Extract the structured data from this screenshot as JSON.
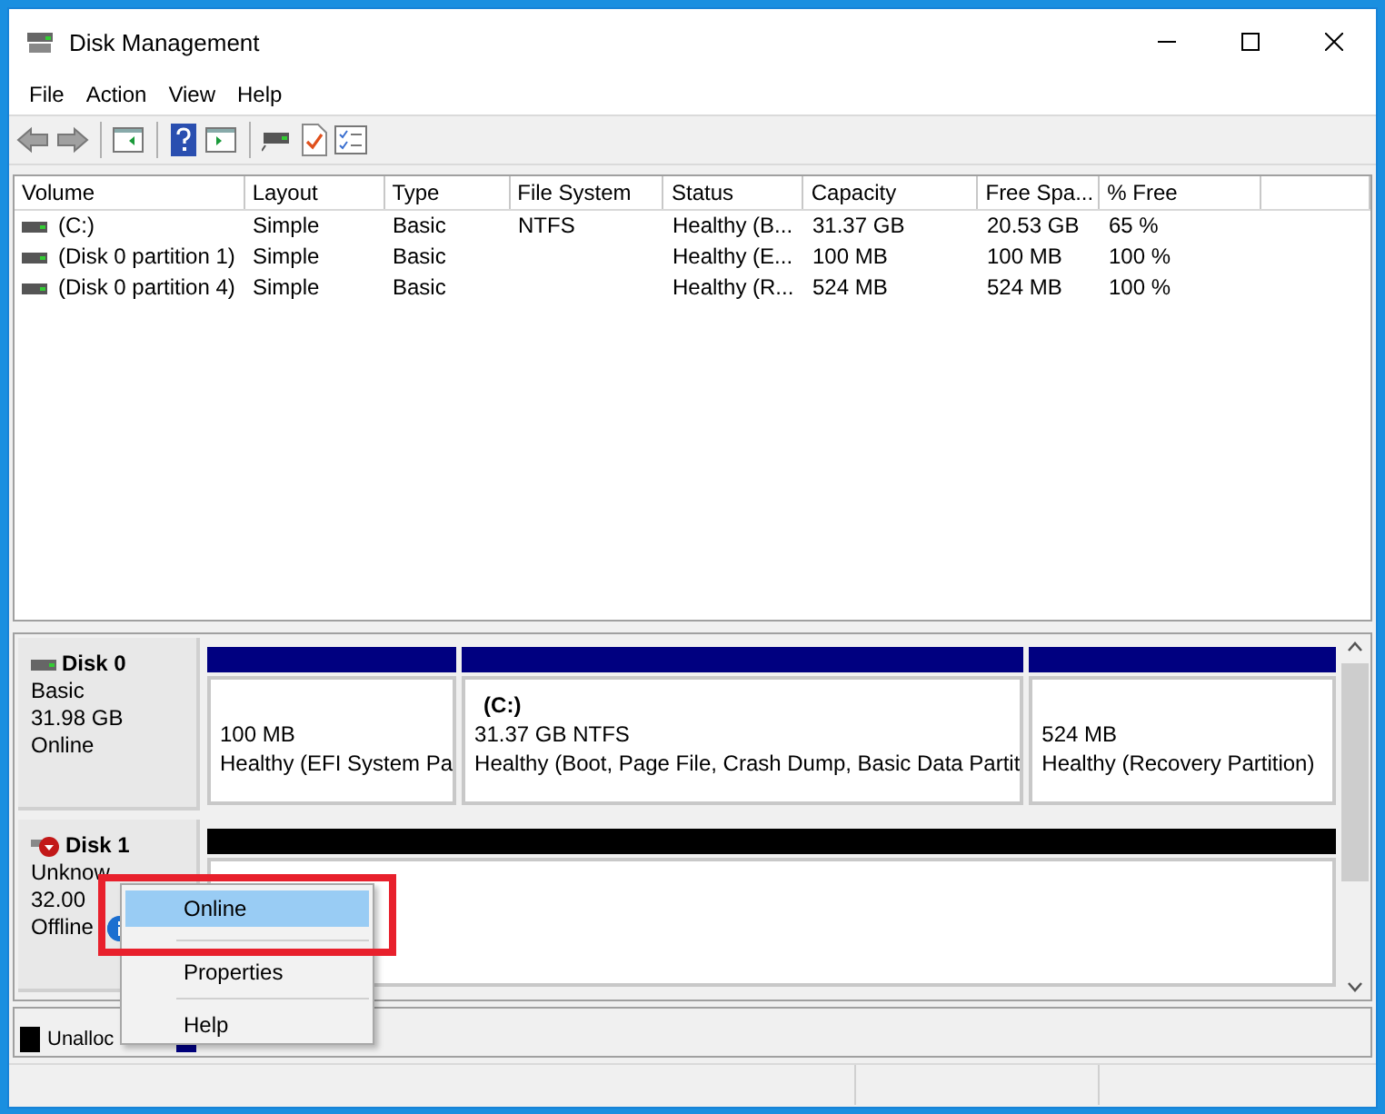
{
  "window": {
    "title": "Disk Management"
  },
  "menu": [
    "File",
    "Action",
    "View",
    "Help"
  ],
  "table": {
    "columns": [
      "Volume",
      "Layout",
      "Type",
      "File System",
      "Status",
      "Capacity",
      "Free Spa...",
      "% Free"
    ],
    "rows": [
      {
        "cells": [
          "(C:)",
          "Simple",
          "Basic",
          "NTFS",
          "Healthy (B...",
          "31.37 GB",
          "20.53 GB",
          "65 %"
        ]
      },
      {
        "cells": [
          "(Disk 0 partition 1)",
          "Simple",
          "Basic",
          "",
          "Healthy (E...",
          "100 MB",
          "100 MB",
          "100 %"
        ]
      },
      {
        "cells": [
          "(Disk 0 partition 4)",
          "Simple",
          "Basic",
          "",
          "Healthy (R...",
          "524 MB",
          "524 MB",
          "100 %"
        ]
      }
    ]
  },
  "disks": [
    {
      "name": "Disk 0",
      "kind": "online",
      "details": [
        "Basic",
        "31.98 GB",
        "Online"
      ],
      "partitions": [
        {
          "color": "#000080",
          "lines": [
            "100 MB",
            "Healthy (EFI System Pa"
          ]
        },
        {
          "color": "#000080",
          "title": "(C:)",
          "lines": [
            "31.37 GB NTFS",
            "Healthy (Boot, Page File, Crash Dump, Basic Data Partit"
          ]
        },
        {
          "color": "#000080",
          "lines": [
            "524 MB",
            "Healthy (Recovery Partition)"
          ]
        }
      ]
    },
    {
      "name": "Disk 1",
      "kind": "offline",
      "details": [
        "Unknow",
        "32.00",
        "Offline"
      ],
      "partitions": [
        {
          "color": "#000000"
        }
      ]
    }
  ],
  "legend": [
    {
      "label": "Unalloc",
      "color": "#000000"
    },
    {
      "color": "#000080"
    }
  ],
  "context_menu": [
    {
      "label": "Online",
      "selected": true
    },
    {
      "label": "Properties",
      "selected": false
    },
    {
      "label": "Help",
      "selected": false
    }
  ]
}
